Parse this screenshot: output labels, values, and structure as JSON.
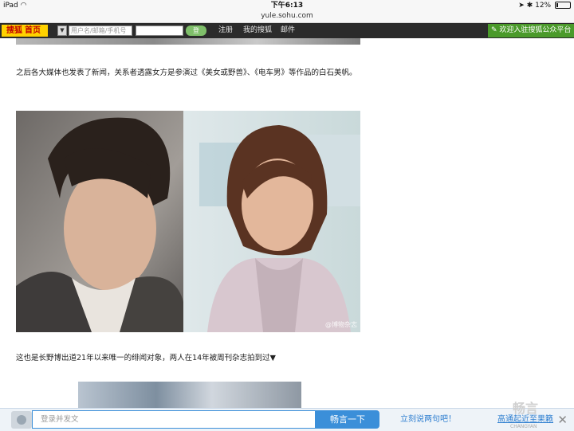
{
  "status_bar": {
    "device": "iPad",
    "time": "下午6:13",
    "battery": "12%",
    "battery_level": 0.12
  },
  "browser": {
    "url": "yule.sohu.com"
  },
  "sohu_nav": {
    "logo": "搜狐",
    "home": "首页",
    "username_placeholder": "用户名/邮箱/手机号",
    "login_button": "登",
    "register": "注册",
    "my_sohu": "我的搜狐",
    "mail": "邮件",
    "cta": "欢迎入驻搜狐公众平台"
  },
  "article": {
    "paragraph1": "之后各大媒体也发表了新闻，关系者透露女方是参演过《美女或野兽》、《电车男》等作品的白石美帆。",
    "photo_watermark": "@博物杂志",
    "paragraph2": "这也是长野博出道21年以来唯一的绯闻对象，两人在14年被周刊杂志拍到过▼"
  },
  "comment_bar": {
    "input_placeholder": "登录并发文",
    "submit_button": "畅言一下",
    "prompt_link": "立刻说两句吧！",
    "hot_link": "高通起近至果籁",
    "brand": "畅言",
    "brand_sub": "CHANGYAN",
    "close": "✕"
  },
  "colors": {
    "nav_bg": "#2b2b2b",
    "logo_bg": "#ffd200",
    "cta_bg": "#4a9a2a",
    "comment_accent": "#3b8fd9"
  }
}
